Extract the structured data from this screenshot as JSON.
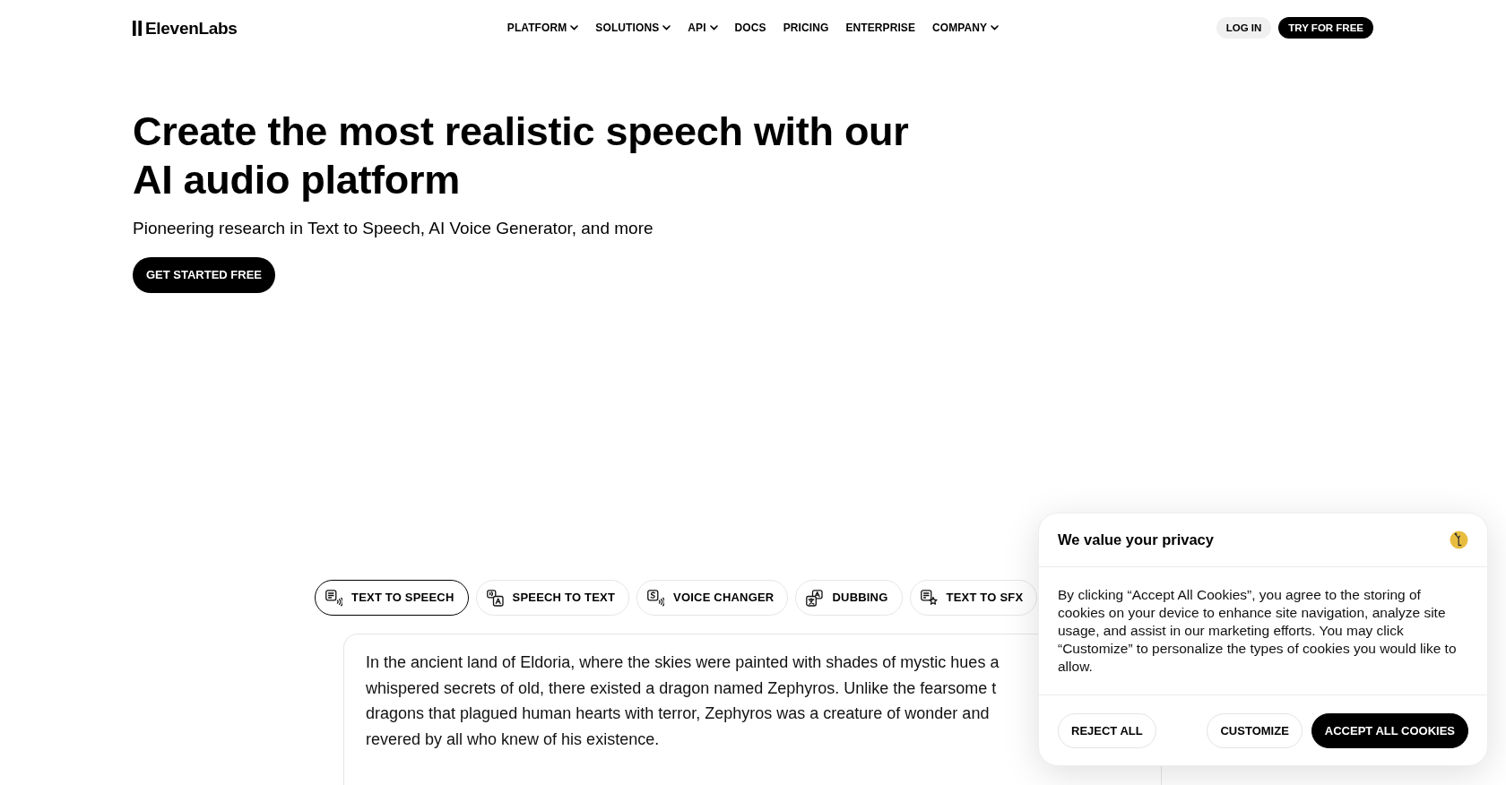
{
  "brand": {
    "name": "ElevenLabs"
  },
  "nav": [
    {
      "label": "PLATFORM",
      "dropdown": true
    },
    {
      "label": "SOLUTIONS",
      "dropdown": true
    },
    {
      "label": "API",
      "dropdown": true
    },
    {
      "label": "DOCS",
      "dropdown": false
    },
    {
      "label": "PRICING",
      "dropdown": false
    },
    {
      "label": "ENTERPRISE",
      "dropdown": false
    },
    {
      "label": "COMPANY",
      "dropdown": true
    }
  ],
  "header_buttons": [
    {
      "label": "LOG IN",
      "kind": "secondary"
    },
    {
      "label": "TRY FOR FREE",
      "kind": "primary"
    }
  ],
  "hero": {
    "title": "Create the most realistic speech with our AI audio platform",
    "subtitle": "Pioneering research in Text to Speech, AI Voice Generator, and more",
    "cta": "GET STARTED FREE"
  },
  "demo": {
    "tabs": [
      {
        "label": "TEXT TO SPEECH",
        "kind": "tts",
        "selected": true
      },
      {
        "label": "SPEECH TO TEXT",
        "kind": "stt",
        "selected": false
      },
      {
        "label": "VOICE CHANGER",
        "kind": "voice",
        "selected": false
      },
      {
        "label": "DUBBING",
        "kind": "dubbing",
        "selected": false
      },
      {
        "label": "TEXT TO SFX",
        "kind": "sfx",
        "selected": false
      }
    ],
    "sample_lines": [
      "In the ancient land of Eldoria, where the skies were painted with shades of mystic hues a",
      "whispered secrets of old, there existed a dragon named Zephyros. Unlike the fearsome t",
      "dragons that plagued human hearts with terror, Zephyros was a creature of wonder and",
      "revered by all who knew of his existence."
    ]
  },
  "cookie_banner": {
    "title": "We value your privacy",
    "body": "By clicking “Accept All Cookies”, you agree to the storing of cookies on your device to enhance site navigation, analyze site usage, and assist in our marketing efforts. You may click “Customize” to personalize the types of cookies you would like to allow.",
    "buttons": [
      {
        "label": "REJECT ALL",
        "kind": "outline"
      },
      {
        "label": "CUSTOMIZE",
        "kind": "outline"
      },
      {
        "label": "ACCEPT ALL COOKIES",
        "kind": "primary"
      }
    ]
  }
}
